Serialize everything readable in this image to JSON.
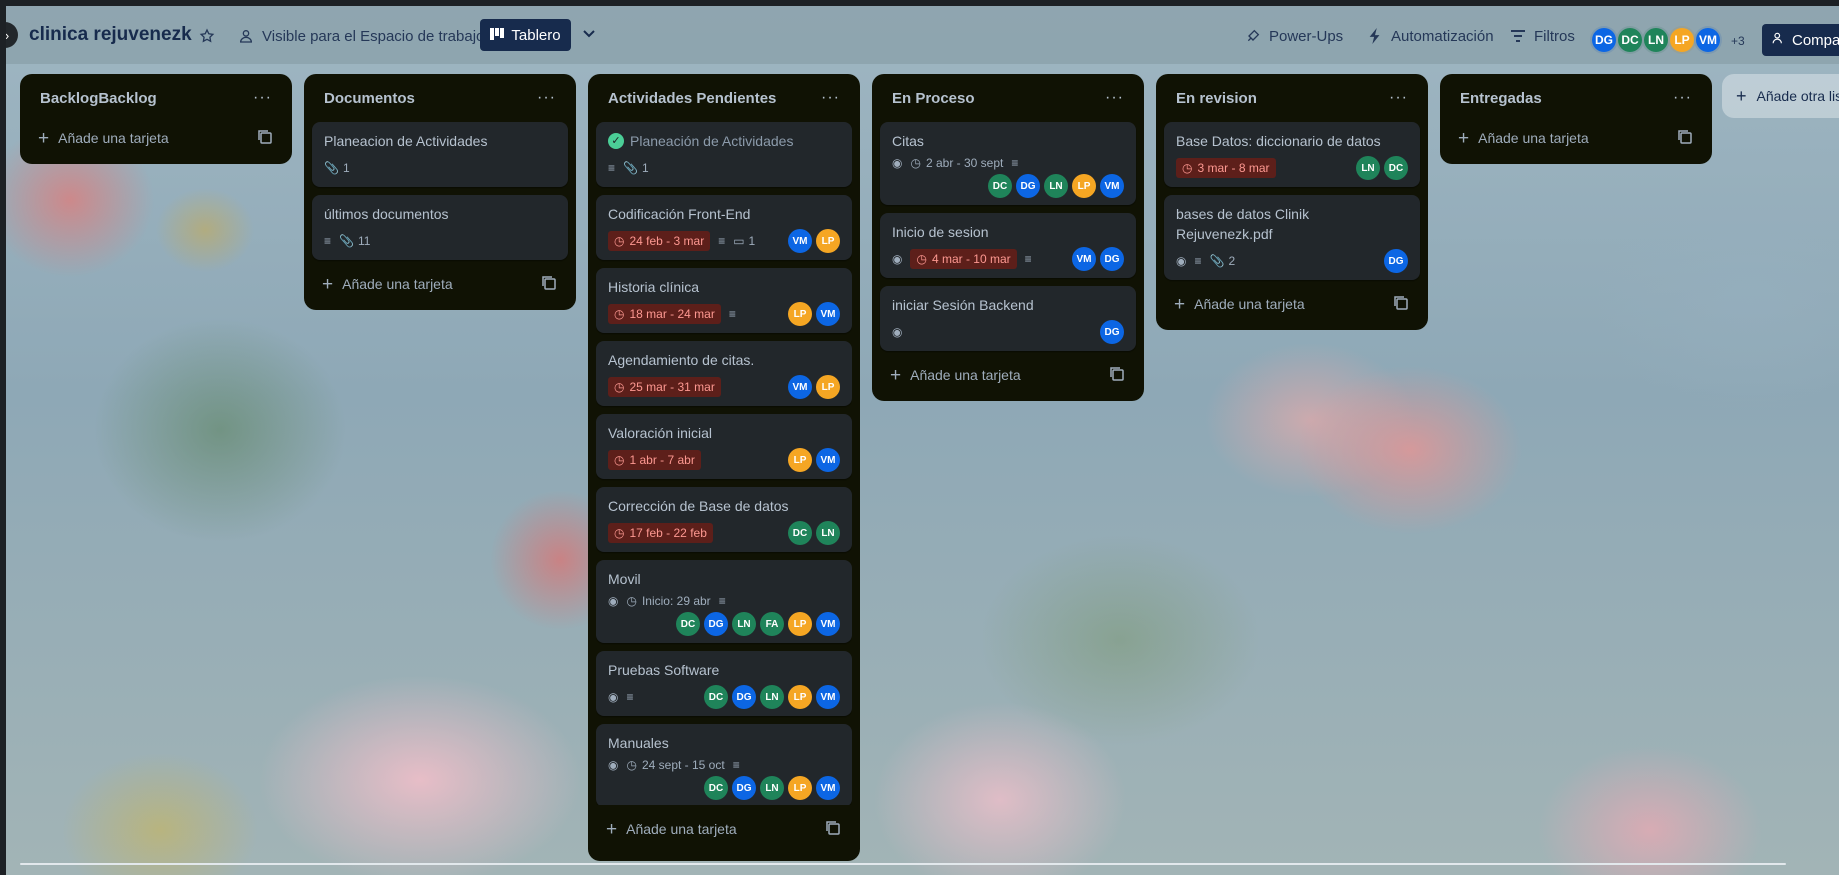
{
  "header": {
    "board_title": "clinica rejuvenezk",
    "visibility_label": "Visible para el Espacio de trabajo",
    "view_label": "Tablero",
    "powerups_label": "Power-Ups",
    "automation_label": "Automatización",
    "filters_label": "Filtros",
    "members": [
      {
        "initials": "DG",
        "color": "#0c66e4"
      },
      {
        "initials": "DC",
        "color": "#1f845a"
      },
      {
        "initials": "LN",
        "color": "#1f845a"
      },
      {
        "initials": "LP",
        "color": "#f5a623"
      },
      {
        "initials": "VM",
        "color": "#0c66e4"
      }
    ],
    "more_members": "+3",
    "share_label": "Compartir"
  },
  "add_card_label": "Añade una tarjeta",
  "add_list_label": "Añade otra lista",
  "lists": [
    {
      "title": "BacklogBacklog",
      "cards": []
    },
    {
      "title": "Documentos",
      "cards": [
        {
          "title": "Planeacion de Actividades",
          "attachments": "1"
        },
        {
          "title": "últimos documentos",
          "attachments": "11"
        }
      ]
    },
    {
      "title": "Actividades Pendientes",
      "cards": [
        {
          "title": "Planeación de Actividades",
          "attachments": "1"
        },
        {
          "title": "Codificación Front-End",
          "date": "24 feb - 3 mar",
          "comments": "1"
        },
        {
          "title": "Historia clínica",
          "date": "18 mar - 24 mar"
        },
        {
          "title": "Agendamiento de citas.",
          "date": "25 mar - 31 mar"
        },
        {
          "title": "Valoración inicial",
          "date": "1 abr - 7 abr"
        },
        {
          "title": "Corrección de Base de datos",
          "date": "17 feb - 22 feb"
        },
        {
          "title": "Movil",
          "date": "Inicio: 29 abr"
        },
        {
          "title": "Pruebas Software"
        },
        {
          "title": "Manuales",
          "date": "24 sept - 15 oct"
        }
      ]
    },
    {
      "title": "En Proceso",
      "cards": [
        {
          "title": "Citas",
          "date": "2 abr - 30 sept"
        },
        {
          "title": "Inicio de sesion",
          "date": "4 mar - 10 mar"
        },
        {
          "title": "iniciar Sesión Backend"
        }
      ]
    },
    {
      "title": "En revision",
      "cards": [
        {
          "title": "Base Datos: diccionario de datos",
          "date": "3 mar - 8 mar"
        },
        {
          "title": "bases de datos Clinik Rejuvenezk.pdf",
          "attachments": "2"
        }
      ]
    },
    {
      "title": "Entregadas",
      "cards": []
    }
  ],
  "colors": {
    "blue": "#0c66e4",
    "green": "#1f845a",
    "orange": "#f5a623",
    "overdue_bg": "#5d1f1a",
    "overdue_text": "#fd9891"
  }
}
